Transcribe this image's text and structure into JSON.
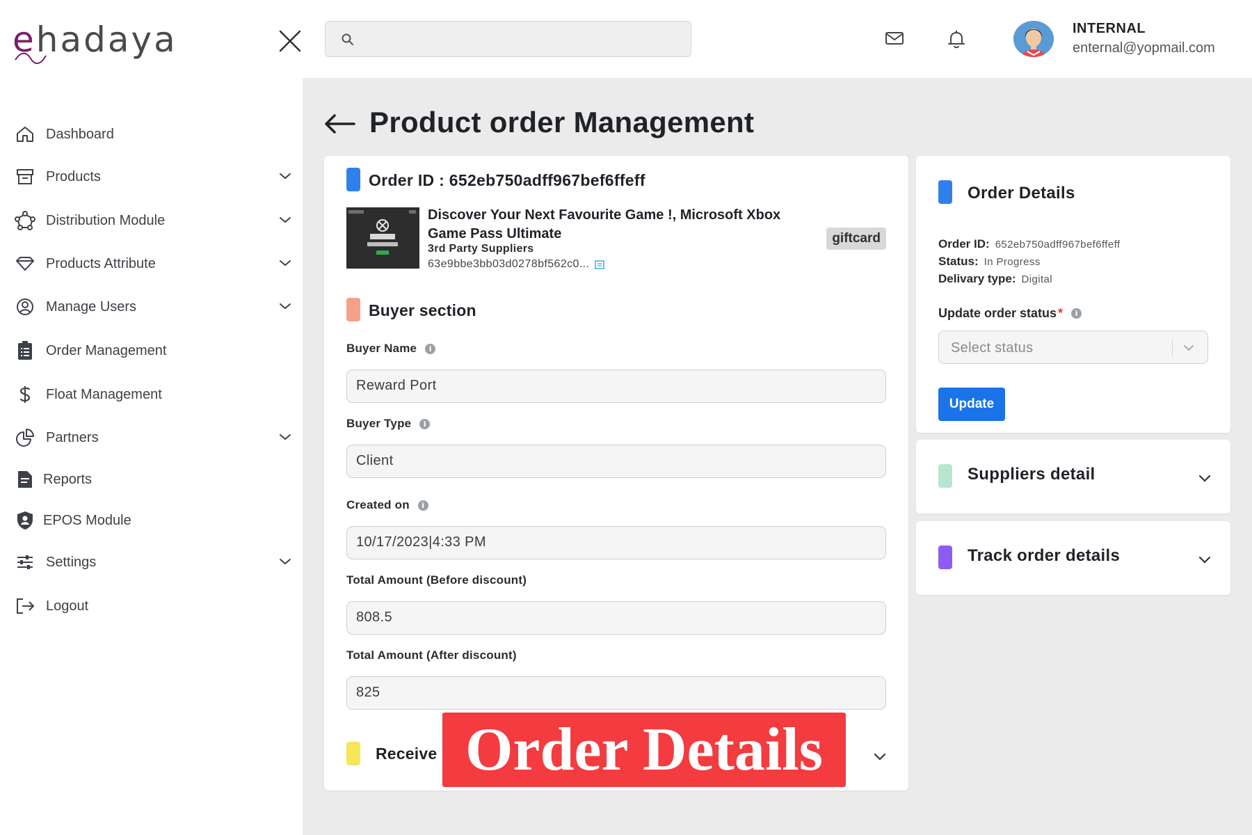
{
  "app": {
    "logo_prefix": "e",
    "logo_rest": "hadaya",
    "brand_color": "#7a1f6b"
  },
  "header": {
    "search": {
      "placeholder": "",
      "value": ""
    },
    "user": {
      "name": "INTERNAL",
      "email": "enternal@yopmail.com"
    },
    "icons": [
      "close-icon",
      "search-icon",
      "mail-icon",
      "bell-icon"
    ]
  },
  "sidebar": {
    "items": [
      {
        "label": "Dashboard",
        "icon": "home-icon",
        "expandable": false
      },
      {
        "label": "Products",
        "icon": "archive-icon",
        "expandable": true
      },
      {
        "label": "Distribution Module",
        "icon": "network-icon",
        "expandable": true
      },
      {
        "label": "Products Attribute",
        "icon": "diamond-icon",
        "expandable": true
      },
      {
        "label": "Manage Users",
        "icon": "user-circle-icon",
        "expandable": true
      },
      {
        "label": "Order Management",
        "icon": "clipboard-icon",
        "expandable": false
      },
      {
        "label": "Float Management",
        "icon": "dollar-icon",
        "expandable": false
      },
      {
        "label": "Partners",
        "icon": "pie-chart-icon",
        "expandable": true
      },
      {
        "label": "Reports",
        "icon": "report-icon",
        "expandable": false
      },
      {
        "label": "EPOS Module",
        "icon": "shield-user-icon",
        "expandable": false
      },
      {
        "label": "Settings",
        "icon": "sliders-icon",
        "expandable": true
      },
      {
        "label": "Logout",
        "icon": "logout-icon",
        "expandable": false
      }
    ]
  },
  "main": {
    "page_title": "Product order Management",
    "order": {
      "id_label": "Order ID : 652eb750adff967bef6ffeff",
      "product_name": "Discover Your Next Favourite Game !, Microsoft Xbox Game Pass Ultimate",
      "supplier": "3rd Party Suppliers",
      "product_id": "63e9bbe3bb03d0278bf562c0...",
      "badge": "giftcard",
      "marker_color": "#2f80ed"
    },
    "buyer_section": {
      "title": "Buyer section",
      "marker_color": "#f4a08a",
      "fields": [
        {
          "label": "Buyer Name",
          "info": true,
          "value": "Reward Port"
        },
        {
          "label": "Buyer Type",
          "info": true,
          "value": "Client"
        },
        {
          "label": "Created on",
          "info": true,
          "value": "10/17/2023|4:33 PM"
        },
        {
          "label": "Total Amount (Before discount)",
          "info": false,
          "value": "808.5"
        },
        {
          "label": "Total Amount (After discount)",
          "info": false,
          "value": "825"
        }
      ]
    },
    "receiver_section": {
      "title": "Receive",
      "marker_color": "#f7e55a"
    },
    "order_details": {
      "title": "Order Details",
      "marker_color": "#2f80ed",
      "order_id_label": "Order ID:",
      "order_id": "652eb750adff967bef6ffeff",
      "status_label": "Status:",
      "status": "In Progress",
      "delivery_label": "Delivary type:",
      "delivery": "Digital",
      "update_label": "Update order status",
      "required_mark": "*",
      "select_placeholder": "Select status",
      "update_button": "Update",
      "button_color": "#1a73e8"
    },
    "suppliers_detail": {
      "title": "Suppliers detail",
      "marker_color": "#b6e6cf"
    },
    "track_order": {
      "title": "Track order details",
      "marker_color": "#8e5cf5"
    }
  },
  "overlay": {
    "text": "Order Details",
    "color": "#f43b3f"
  }
}
